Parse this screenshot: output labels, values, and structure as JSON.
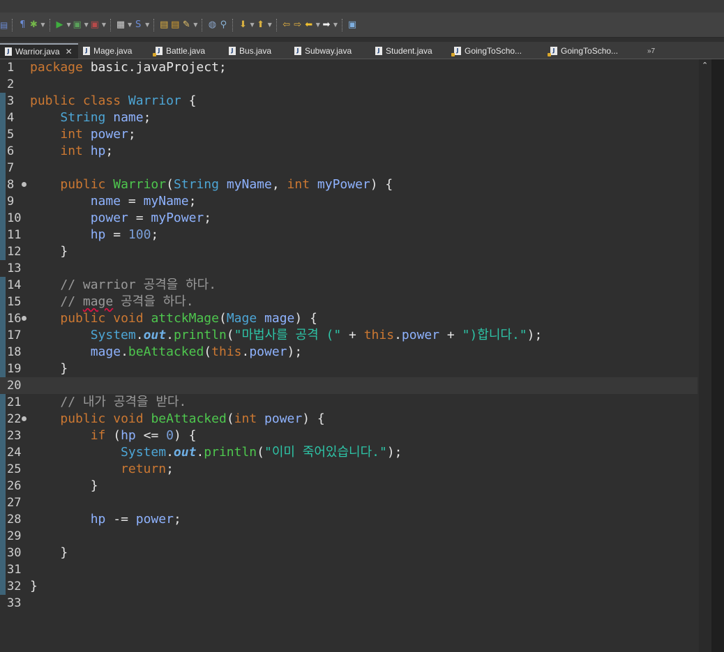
{
  "toolbar": {
    "buttons": [
      {
        "name": "pilcrow-icon",
        "glyph": "¶",
        "color": "#6c8cd5",
        "dropdown": false
      },
      {
        "name": "debug-icon",
        "glyph": "✱",
        "color": "#74b84a",
        "dropdown": true
      },
      {
        "name": "run-icon",
        "glyph": "▶",
        "color": "#3fae3f",
        "dropdown": true
      },
      {
        "name": "run-config-icon",
        "glyph": "▣",
        "color": "#5aa05a",
        "dropdown": true
      },
      {
        "name": "external-tools-icon",
        "glyph": "▣",
        "color": "#b84a4a",
        "dropdown": true
      },
      {
        "name": "new-package-icon",
        "glyph": "▦",
        "color": "#cfcfcf",
        "dropdown": true
      },
      {
        "name": "new-class-icon",
        "glyph": "S",
        "color": "#6c8cd5",
        "dropdown": true
      },
      {
        "name": "open-type-icon",
        "glyph": "▤",
        "color": "#e0b040",
        "dropdown": false
      },
      {
        "name": "open-folder-icon",
        "glyph": "▤",
        "color": "#d8a030",
        "dropdown": false
      },
      {
        "name": "brush-icon",
        "glyph": "✎",
        "color": "#e6c46a",
        "dropdown": true
      },
      {
        "name": "globe-icon",
        "glyph": "◍",
        "color": "#8aa4c8",
        "dropdown": false
      },
      {
        "name": "search-icon",
        "glyph": "⚲",
        "color": "#8ab4d8",
        "dropdown": false
      },
      {
        "name": "annotation-down-icon",
        "glyph": "⬇",
        "color": "#d8b040",
        "dropdown": true
      },
      {
        "name": "annotation-up-icon",
        "glyph": "⬆",
        "color": "#d8b040",
        "dropdown": true
      },
      {
        "name": "last-edit-icon",
        "glyph": "⇦",
        "color": "#e0b040",
        "dropdown": false
      },
      {
        "name": "next-edit-icon",
        "glyph": "⇨",
        "color": "#e0b040",
        "dropdown": false
      },
      {
        "name": "back-icon",
        "glyph": "⬅",
        "color": "#f0c030",
        "dropdown": true
      },
      {
        "name": "forward-icon",
        "glyph": "➡",
        "color": "#f0f0f0",
        "dropdown": true
      },
      {
        "name": "perspective-icon",
        "glyph": "▣",
        "color": "#7fb0e0",
        "dropdown": false
      }
    ]
  },
  "tabs": [
    {
      "label": "Warrior.java",
      "active": true,
      "closable": true,
      "icon": "java-file-icon"
    },
    {
      "label": "Mage.java",
      "active": false,
      "icon": "java-file-icon"
    },
    {
      "label": "Battle.java",
      "active": false,
      "icon": "java-run-file-icon"
    },
    {
      "label": "Bus.java",
      "active": false,
      "icon": "java-file-icon"
    },
    {
      "label": "Subway.java",
      "active": false,
      "icon": "java-file-icon"
    },
    {
      "label": "Student.java",
      "active": false,
      "icon": "java-file-icon"
    },
    {
      "label": "GoingToScho...",
      "active": false,
      "icon": "java-run-file-icon"
    },
    {
      "label": "GoingToScho...",
      "active": false,
      "icon": "java-run-file-icon"
    }
  ],
  "tabs_overflow": "»7",
  "editor": {
    "current_line": 20,
    "lines": [
      {
        "n": "1",
        "fold": false,
        "tokens": [
          [
            "kw",
            "package"
          ],
          [
            "pl",
            " basic.javaProject;"
          ]
        ]
      },
      {
        "n": "2",
        "fold": false,
        "tokens": []
      },
      {
        "n": "3",
        "fold": false,
        "tokens": [
          [
            "kw",
            "public"
          ],
          [
            "pl",
            " "
          ],
          [
            "kw",
            "class"
          ],
          [
            "pl",
            " "
          ],
          [
            "ty",
            "Warrior"
          ],
          [
            "pl",
            " {"
          ]
        ]
      },
      {
        "n": "4",
        "fold": false,
        "tokens": [
          [
            "pl",
            "    "
          ],
          [
            "ty",
            "String"
          ],
          [
            "pl",
            " "
          ],
          [
            "fld",
            "name"
          ],
          [
            "pl",
            ";"
          ]
        ]
      },
      {
        "n": "5",
        "fold": false,
        "tokens": [
          [
            "pl",
            "    "
          ],
          [
            "kw",
            "int"
          ],
          [
            "pl",
            " "
          ],
          [
            "fld",
            "power"
          ],
          [
            "pl",
            ";"
          ]
        ]
      },
      {
        "n": "6",
        "fold": false,
        "tokens": [
          [
            "pl",
            "    "
          ],
          [
            "kw",
            "int"
          ],
          [
            "pl",
            " "
          ],
          [
            "fld",
            "hp"
          ],
          [
            "pl",
            ";"
          ]
        ]
      },
      {
        "n": "7",
        "fold": false,
        "tokens": []
      },
      {
        "n": "8",
        "fold": true,
        "tokens": [
          [
            "pl",
            "    "
          ],
          [
            "kw",
            "public"
          ],
          [
            "pl",
            " "
          ],
          [
            "fn",
            "Warrior"
          ],
          [
            "pl",
            "("
          ],
          [
            "ty",
            "String"
          ],
          [
            "pl",
            " "
          ],
          [
            "fld",
            "myName"
          ],
          [
            "pl",
            ", "
          ],
          [
            "kw",
            "int"
          ],
          [
            "pl",
            " "
          ],
          [
            "fld",
            "myPower"
          ],
          [
            "pl",
            ") {"
          ]
        ]
      },
      {
        "n": "9",
        "fold": false,
        "tokens": [
          [
            "pl",
            "        "
          ],
          [
            "fld",
            "name"
          ],
          [
            "pl",
            " = "
          ],
          [
            "fld",
            "myName"
          ],
          [
            "pl",
            ";"
          ]
        ]
      },
      {
        "n": "10",
        "fold": false,
        "tokens": [
          [
            "pl",
            "        "
          ],
          [
            "fld",
            "power"
          ],
          [
            "pl",
            " = "
          ],
          [
            "fld",
            "myPower"
          ],
          [
            "pl",
            ";"
          ]
        ]
      },
      {
        "n": "11",
        "fold": false,
        "tokens": [
          [
            "pl",
            "        "
          ],
          [
            "fld",
            "hp"
          ],
          [
            "pl",
            " = "
          ],
          [
            "num",
            "100"
          ],
          [
            "pl",
            ";"
          ]
        ]
      },
      {
        "n": "12",
        "fold": false,
        "tokens": [
          [
            "pl",
            "    }"
          ]
        ]
      },
      {
        "n": "13",
        "fold": false,
        "tokens": []
      },
      {
        "n": "14",
        "fold": false,
        "tokens": [
          [
            "pl",
            "    "
          ],
          [
            "cm",
            "// warrior 공격을 하다."
          ]
        ]
      },
      {
        "n": "15",
        "fold": false,
        "tokens": [
          [
            "pl",
            "    "
          ],
          [
            "cm",
            "// "
          ],
          [
            "cm squig",
            "mage"
          ],
          [
            "cm",
            " 공격을 하다."
          ]
        ]
      },
      {
        "n": "16",
        "fold": true,
        "tokens": [
          [
            "pl",
            "    "
          ],
          [
            "kw",
            "public"
          ],
          [
            "pl",
            " "
          ],
          [
            "kw",
            "void"
          ],
          [
            "pl",
            " "
          ],
          [
            "fn",
            "attckMage"
          ],
          [
            "pl",
            "("
          ],
          [
            "ty",
            "Mage"
          ],
          [
            "pl",
            " "
          ],
          [
            "fld",
            "mage"
          ],
          [
            "pl",
            ") {"
          ]
        ]
      },
      {
        "n": "17",
        "fold": false,
        "tokens": [
          [
            "pl",
            "        "
          ],
          [
            "ty",
            "System"
          ],
          [
            "pl",
            "."
          ],
          [
            "st",
            "out"
          ],
          [
            "pl",
            "."
          ],
          [
            "fn",
            "println"
          ],
          [
            "pl",
            "("
          ],
          [
            "str",
            "\"마법사를 공격 (\""
          ],
          [
            "pl",
            " + "
          ],
          [
            "kw",
            "this"
          ],
          [
            "pl",
            "."
          ],
          [
            "fld",
            "power"
          ],
          [
            "pl",
            " + "
          ],
          [
            "str",
            "\")합니다.\""
          ],
          [
            "pl",
            ");"
          ]
        ]
      },
      {
        "n": "18",
        "fold": false,
        "tokens": [
          [
            "pl",
            "        "
          ],
          [
            "fld",
            "mage"
          ],
          [
            "pl",
            "."
          ],
          [
            "fn",
            "beAttacked"
          ],
          [
            "pl",
            "("
          ],
          [
            "kw",
            "this"
          ],
          [
            "pl",
            "."
          ],
          [
            "fld",
            "power"
          ],
          [
            "pl",
            ");"
          ]
        ]
      },
      {
        "n": "19",
        "fold": false,
        "tokens": [
          [
            "pl",
            "    }"
          ]
        ]
      },
      {
        "n": "20",
        "fold": false,
        "tokens": []
      },
      {
        "n": "21",
        "fold": false,
        "tokens": [
          [
            "pl",
            "    "
          ],
          [
            "cm",
            "// 내가 공격을 받다."
          ]
        ]
      },
      {
        "n": "22",
        "fold": true,
        "tokens": [
          [
            "pl",
            "    "
          ],
          [
            "kw",
            "public"
          ],
          [
            "pl",
            " "
          ],
          [
            "kw",
            "void"
          ],
          [
            "pl",
            " "
          ],
          [
            "fn",
            "beAttacked"
          ],
          [
            "pl",
            "("
          ],
          [
            "kw",
            "int"
          ],
          [
            "pl",
            " "
          ],
          [
            "fld",
            "power"
          ],
          [
            "pl",
            ") {"
          ]
        ]
      },
      {
        "n": "23",
        "fold": false,
        "tokens": [
          [
            "pl",
            "        "
          ],
          [
            "kw",
            "if"
          ],
          [
            "pl",
            " ("
          ],
          [
            "fld",
            "hp"
          ],
          [
            "pl",
            " <= "
          ],
          [
            "num",
            "0"
          ],
          [
            "pl",
            ") {"
          ]
        ]
      },
      {
        "n": "24",
        "fold": false,
        "tokens": [
          [
            "pl",
            "            "
          ],
          [
            "ty",
            "System"
          ],
          [
            "pl",
            "."
          ],
          [
            "st",
            "out"
          ],
          [
            "pl",
            "."
          ],
          [
            "fn",
            "println"
          ],
          [
            "pl",
            "("
          ],
          [
            "str",
            "\"이미 죽어있습니다.\""
          ],
          [
            "pl",
            ");"
          ]
        ]
      },
      {
        "n": "25",
        "fold": false,
        "tokens": [
          [
            "pl",
            "            "
          ],
          [
            "kw",
            "return"
          ],
          [
            "pl",
            ";"
          ]
        ]
      },
      {
        "n": "26",
        "fold": false,
        "tokens": [
          [
            "pl",
            "        }"
          ]
        ]
      },
      {
        "n": "27",
        "fold": false,
        "tokens": []
      },
      {
        "n": "28",
        "fold": false,
        "tokens": [
          [
            "pl",
            "        "
          ],
          [
            "fld",
            "hp"
          ],
          [
            "pl",
            " -= "
          ],
          [
            "fld",
            "power"
          ],
          [
            "pl",
            ";"
          ]
        ]
      },
      {
        "n": "29",
        "fold": false,
        "tokens": []
      },
      {
        "n": "30",
        "fold": false,
        "tokens": [
          [
            "pl",
            "    }"
          ]
        ]
      },
      {
        "n": "31",
        "fold": false,
        "tokens": []
      },
      {
        "n": "32",
        "fold": false,
        "tokens": [
          [
            "pl",
            "}"
          ]
        ]
      },
      {
        "n": "33",
        "fold": false,
        "tokens": []
      }
    ]
  },
  "scrollbar": {
    "up_glyph": "⌃"
  }
}
